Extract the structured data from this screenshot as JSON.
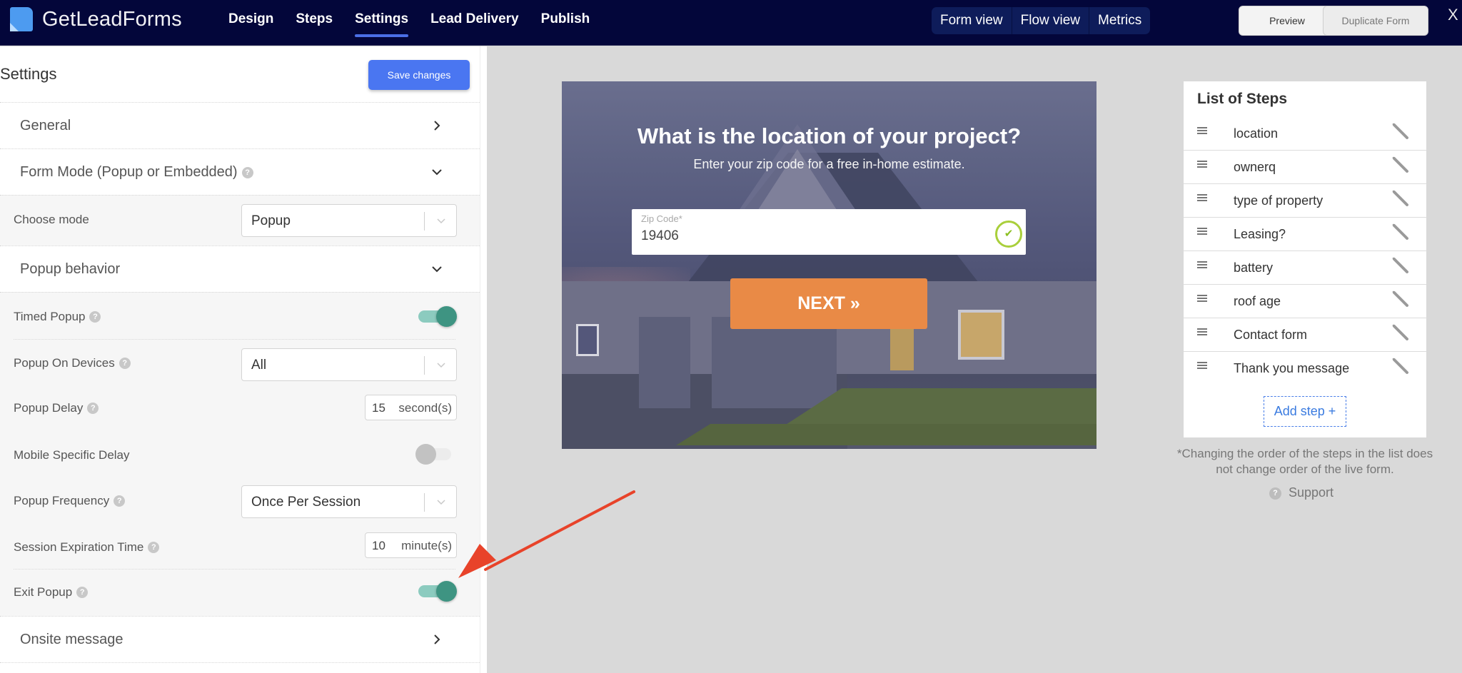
{
  "header": {
    "brand": "GetLeadForms",
    "nav": [
      {
        "label": "Design",
        "active": false
      },
      {
        "label": "Steps",
        "active": false
      },
      {
        "label": "Settings",
        "active": true
      },
      {
        "label": "Lead Delivery",
        "active": false
      },
      {
        "label": "Publish",
        "active": false
      }
    ],
    "view_tabs": [
      "Form view",
      "Flow view",
      "Metrics"
    ],
    "preview_label": "Preview",
    "duplicate_label": "Duplicate Form",
    "close_label": "X"
  },
  "settings": {
    "title": "Settings",
    "save_label": "Save changes",
    "sections": {
      "general": "General",
      "form_mode": "Form Mode (Popup or Embedded)",
      "popup_behavior": "Popup behavior",
      "onsite_message": "Onsite message"
    },
    "choose_mode": {
      "label": "Choose mode",
      "value": "Popup"
    },
    "timed_popup": {
      "label": "Timed Popup",
      "enabled": true
    },
    "popup_on_devices": {
      "label": "Popup On Devices",
      "value": "All"
    },
    "popup_delay": {
      "label": "Popup Delay",
      "value": "15",
      "unit": "second(s)"
    },
    "mobile_specific_delay": {
      "label": "Mobile Specific Delay",
      "enabled": false
    },
    "popup_frequency": {
      "label": "Popup Frequency",
      "value": "Once Per Session"
    },
    "session_expiration": {
      "label": "Session Expiration Time",
      "value": "10",
      "unit": "minute(s)"
    },
    "exit_popup": {
      "label": "Exit Popup",
      "enabled": true
    },
    "help_glyph": "?"
  },
  "form_preview": {
    "question": "What is the location of your project?",
    "subtitle": "Enter your zip code for a free in-home estimate.",
    "zip_label": "Zip Code*",
    "zip_value": "19406",
    "check_glyph": "✔",
    "next_label": "NEXT »"
  },
  "steps_panel": {
    "title": "List of Steps",
    "steps": [
      "location",
      "ownerq",
      "type of property",
      "Leasing?",
      "battery",
      "roof age",
      "Contact form",
      "Thank you message"
    ],
    "add_label": "Add step +",
    "note": "*Changing the order of the steps in the list does not change order of the live form.",
    "support_label": "Support"
  },
  "colors": {
    "header_bg": "#03063a",
    "accent_blue": "#4a76f1",
    "toggle_on": "#3e9482",
    "next_button": "#e98a46",
    "annotation_arrow": "#e8432a"
  }
}
